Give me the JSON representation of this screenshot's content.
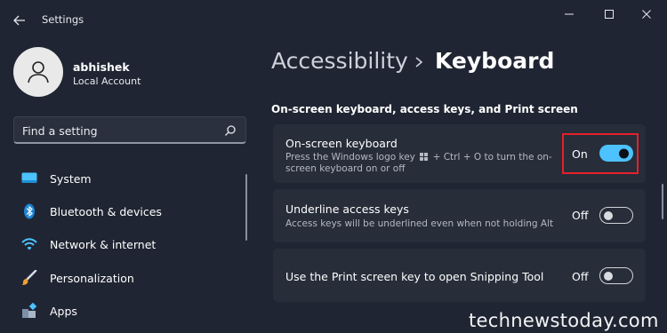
{
  "window": {
    "title": "Settings"
  },
  "profile": {
    "name": "abhishek",
    "account_type": "Local Account"
  },
  "search": {
    "placeholder": "Find a setting"
  },
  "sidebar": {
    "items": [
      {
        "label": "System",
        "icon": "system-icon"
      },
      {
        "label": "Bluetooth & devices",
        "icon": "bluetooth-icon"
      },
      {
        "label": "Network & internet",
        "icon": "wifi-icon"
      },
      {
        "label": "Personalization",
        "icon": "brush-icon"
      },
      {
        "label": "Apps",
        "icon": "apps-icon"
      }
    ]
  },
  "breadcrumb": {
    "parent": "Accessibility",
    "current": "Keyboard"
  },
  "section": {
    "title": "On-screen keyboard, access keys, and Print screen"
  },
  "settings": [
    {
      "title": "On-screen keyboard",
      "desc_line1": "Press the Windows logo key",
      "desc_line1_after": "+ Ctrl + O to turn the on-",
      "desc_line2": "screen keyboard on or off",
      "state_label": "On",
      "on": true
    },
    {
      "title": "Underline access keys",
      "desc": "Access keys will be underlined even when not holding Alt",
      "state_label": "Off",
      "on": false
    },
    {
      "title": "Use the Print screen key to open Snipping Tool",
      "state_label": "Off",
      "on": false
    }
  ],
  "watermark": "technewstoday.com",
  "colors": {
    "background": "#1f2532",
    "card": "#272d39",
    "accent": "#4cc2ff",
    "highlight": "#e5202a"
  }
}
